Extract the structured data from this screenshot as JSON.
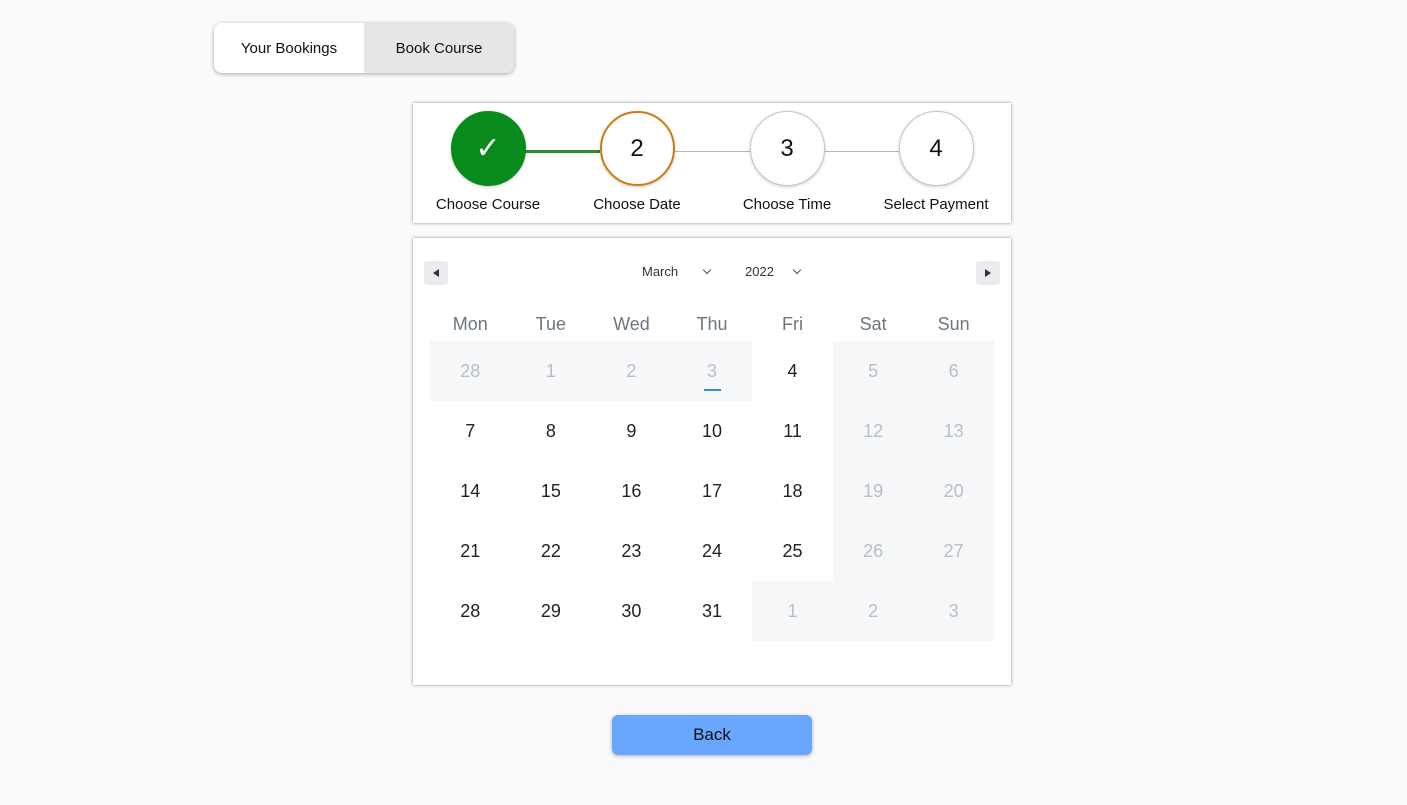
{
  "tabs": [
    {
      "label": "Your Bookings",
      "active": false
    },
    {
      "label": "Book Course",
      "active": true
    }
  ],
  "stepper": {
    "steps": [
      {
        "number": "✓",
        "label": "Choose Course",
        "state": "done"
      },
      {
        "number": "2",
        "label": "Choose Date",
        "state": "current"
      },
      {
        "number": "3",
        "label": "Choose Time",
        "state": "pending"
      },
      {
        "number": "4",
        "label": "Select Payment",
        "state": "pending"
      }
    ],
    "colors": {
      "done": "#088a1c",
      "current": "#d07a14"
    }
  },
  "calendar": {
    "prev_icon": "caret-left-icon",
    "next_icon": "caret-right-icon",
    "month": "March",
    "year": "2022",
    "weekdays": [
      "Mon",
      "Tue",
      "Wed",
      "Thu",
      "Fri",
      "Sat",
      "Sun"
    ],
    "weeks": [
      [
        {
          "d": "28",
          "off": true
        },
        {
          "d": "1",
          "off": true
        },
        {
          "d": "2",
          "off": true
        },
        {
          "d": "3",
          "off": true,
          "today": true
        },
        {
          "d": "4"
        },
        {
          "d": "5",
          "off": true
        },
        {
          "d": "6",
          "off": true
        }
      ],
      [
        {
          "d": "7"
        },
        {
          "d": "8"
        },
        {
          "d": "9"
        },
        {
          "d": "10"
        },
        {
          "d": "11"
        },
        {
          "d": "12",
          "off": true
        },
        {
          "d": "13",
          "off": true
        }
      ],
      [
        {
          "d": "14"
        },
        {
          "d": "15"
        },
        {
          "d": "16"
        },
        {
          "d": "17"
        },
        {
          "d": "18"
        },
        {
          "d": "19",
          "off": true
        },
        {
          "d": "20",
          "off": true
        }
      ],
      [
        {
          "d": "21"
        },
        {
          "d": "22"
        },
        {
          "d": "23"
        },
        {
          "d": "24"
        },
        {
          "d": "25"
        },
        {
          "d": "26",
          "off": true
        },
        {
          "d": "27",
          "off": true
        }
      ],
      [
        {
          "d": "28"
        },
        {
          "d": "29"
        },
        {
          "d": "30"
        },
        {
          "d": "31"
        },
        {
          "d": "1",
          "off": true
        },
        {
          "d": "2",
          "off": true
        },
        {
          "d": "3",
          "off": true
        }
      ]
    ]
  },
  "back_button": {
    "label": "Back",
    "color": "#69a6fd"
  }
}
